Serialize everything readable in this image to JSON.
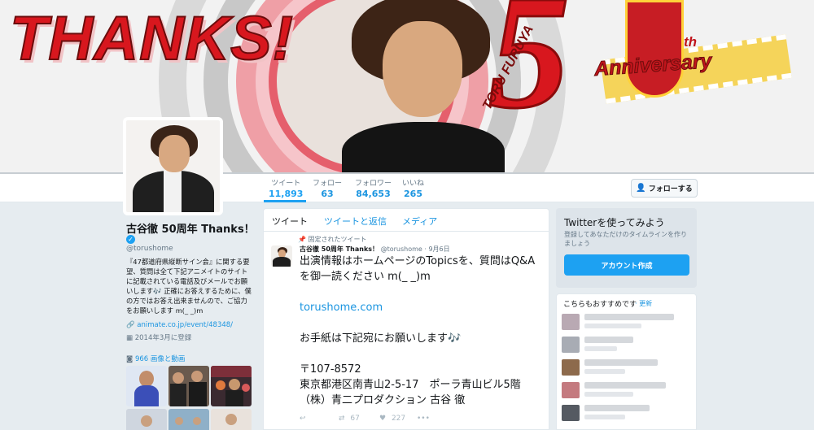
{
  "banner": {
    "thanks": "THANKS!",
    "fifty": "5",
    "toru": "TORU FURUYA",
    "anniversary": "Anniversary",
    "th": "th"
  },
  "nav": {
    "stats": [
      {
        "label": "ツイート",
        "value": "11,893"
      },
      {
        "label": "フォロー",
        "value": "63"
      },
      {
        "label": "フォロワー",
        "value": "84,653"
      },
      {
        "label": "いいね",
        "value": "265"
      }
    ],
    "follow_button": "フォローする"
  },
  "profile": {
    "name": "古谷徹 50周年 Thanks！",
    "verified": "✓",
    "handle": "@torushome",
    "bio_1": "『47都道府県縦断サイン会』に関する要望、質問は全て下記アニメイトのサイトに記載されている電話及びメールでお願いします",
    "bio_2": "正確にお答えするために、僕の方ではお答え出来ませんので、ご協力をお願いします m(_ _)m",
    "bio_note": "🎶",
    "link": "animate.co.jp/event/48348/",
    "joined": "2014年3月に登録",
    "media": "966 画像と動画"
  },
  "timeline": {
    "tabs": [
      "ツイート",
      "ツイートと返信",
      "メディア"
    ],
    "pinned_label": "固定されたツイート",
    "tweet": {
      "name": "古谷徹 50周年 Thanks！",
      "handle": "@torushome",
      "date": "· 9月6日",
      "text_1": "出演情報はホームページのTopicsを、質問はQ&Aを御一読ください m(_ _)m",
      "link": "torushome.com",
      "text_2": "お手紙は下記宛にお願いします🎶",
      "text_3": "〒107-8572\n東京都港区南青山2-5-17　ポーラ青山ビル5階（株）青二プロダクション 古谷 徹",
      "reply": "↩",
      "retweet_icon": "⇄",
      "retweets": "67",
      "like_icon": "♥",
      "likes": "227",
      "more": "•••"
    }
  },
  "signup": {
    "title": "Twitterを使ってみよう",
    "text": "登録してあなただけのタイムラインを作りましょう",
    "button": "アカウント作成"
  },
  "who_to_follow": {
    "title": "こちらもおすすめです",
    "refresh": "· 更新"
  }
}
